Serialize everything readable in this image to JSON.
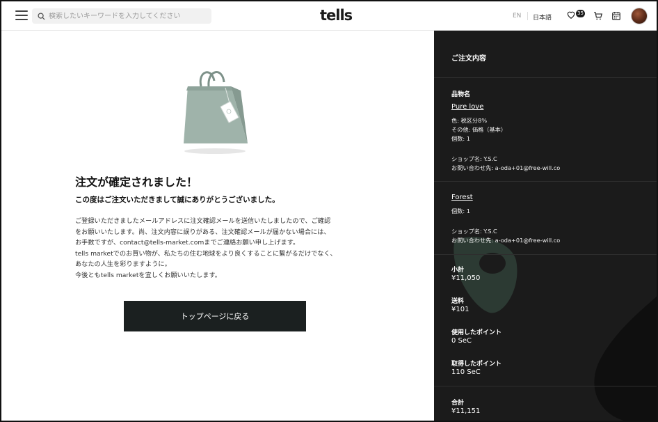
{
  "header": {
    "search_placeholder": "検索したいキーワードを入力してください",
    "logo": "tells",
    "lang_en": "EN",
    "lang_ja": "日本語",
    "favorites_count": "35",
    "icons": [
      "menu-icon",
      "search-icon",
      "heart-icon",
      "cart-icon",
      "calendar-icon",
      "avatar"
    ]
  },
  "main": {
    "title": "注文が確定されました！",
    "subtitle": "この度はご注文いただきまして誠にありがとうございました。",
    "body_lines": [
      "ご登録いただきましたメールアドレスに注文確認メールを送信いたしましたので、ご確認",
      "をお願いいたします。尚、注文内容に誤りがある、注文確認メールが届かない場合には、",
      "お手数ですが、contact@tells-market.comまでご連絡お願い申し上げます。",
      "tells marketでのお買い物が、私たちの住む地球をより良くすることに繋がるだけでなく、",
      "あなたの人生を彩りますように。",
      "今後ともtells marketを宜しくお願いいたします。"
    ],
    "top_button": "トップページに戻る"
  },
  "sidebar": {
    "heading": "ご注文内容",
    "item_name_label": "品物名",
    "item1": {
      "name": "Pure love",
      "color": "色: 税区分8%",
      "other": "その他: 価格（基本）",
      "qty": "個数: 1",
      "shop": "ショップ名: Y.S.C",
      "contact": "お問い合わせ先:  a-oda+01@free-will.co"
    },
    "item2": {
      "name": "Forest",
      "qty": "個数: 1",
      "shop": "ショップ名: Y.S.C",
      "contact": "お問い合わせ先:  a-oda+01@free-will.co"
    },
    "subtotal_label": "小計",
    "subtotal": "¥11,050",
    "shipping_label": "送料",
    "shipping": "¥101",
    "used_points_label": "使用したポイント",
    "used_points": "0 SeC",
    "earned_points_label": "取得したポイント",
    "earned_points": "110 SeC",
    "total_label": "合計",
    "total": "¥11,151"
  },
  "colors": {
    "sidebar_bg": "#1b1b1b",
    "button_bg": "#1b2020",
    "bag": "#9fb3aa",
    "deco_green": "#2c3a33"
  }
}
